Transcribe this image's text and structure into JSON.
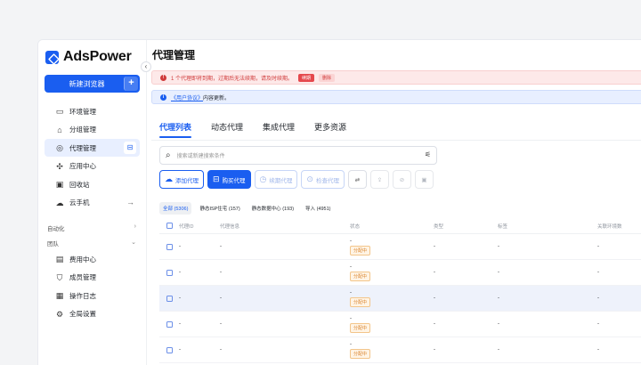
{
  "app": {
    "name": "AdsPower"
  },
  "sidebar": {
    "new_browser": "新建浏览器",
    "new_plus": "+",
    "items": [
      {
        "label": "环境管理",
        "icon": "browser-window-icon"
      },
      {
        "label": "分组管理",
        "icon": "folder-icon"
      },
      {
        "label": "代理管理",
        "icon": "proxy-globe-icon",
        "active": true
      },
      {
        "label": "应用中心",
        "icon": "puzzle-icon"
      },
      {
        "label": "回收站",
        "icon": "trash-icon"
      },
      {
        "label": "云手机",
        "icon": "cloud-phone-icon"
      }
    ],
    "group_automation": "自动化",
    "group_team": "团队",
    "team_items": [
      {
        "label": "费用中心",
        "icon": "billing-icon"
      },
      {
        "label": "成员管理",
        "icon": "shield-user-icon"
      },
      {
        "label": "操作日志",
        "icon": "log-icon"
      },
      {
        "label": "全局设置",
        "icon": "settings-icon"
      }
    ]
  },
  "page": {
    "title": "代理管理"
  },
  "alerts": {
    "expire_text": "1 个代理即将到期，过期后无法续期，请及时续期。",
    "renew": "续期",
    "delete": "删除",
    "agreement_link": "《用户协议》",
    "agreement_suffix": "内容更新。"
  },
  "tabs": [
    "代理列表",
    "动态代理",
    "集成代理",
    "更多资源"
  ],
  "search": {
    "placeholder": "搜索或新建搜索条件"
  },
  "toolbar": {
    "add_proxy": "添加代理",
    "buy_proxy": "购买代理",
    "renew_proxy": "续期代理",
    "check_proxy": "检查代理"
  },
  "filters": [
    "全部 (5306)",
    "静态ISP住宅 (157)",
    "静态数据中心 (193)",
    "导入 (4951)"
  ],
  "table": {
    "columns": [
      "代理ID",
      "代理信息",
      "状态",
      "类型",
      "标签",
      "关联环境数"
    ],
    "status_line": "-",
    "status_badge": "分配中",
    "rows": [
      {
        "id": "-",
        "info": "-",
        "type": "-",
        "tag": "-",
        "count": "-"
      },
      {
        "id": "-",
        "info": "-",
        "type": "-",
        "tag": "-",
        "count": "-"
      },
      {
        "id": "-",
        "info": "-",
        "type": "-",
        "tag": "-",
        "count": "-",
        "highlight": true
      },
      {
        "id": "-",
        "info": "-",
        "type": "-",
        "tag": "-",
        "count": "-"
      },
      {
        "id": "-",
        "info": "-",
        "type": "-",
        "tag": "-",
        "count": "-"
      }
    ]
  }
}
